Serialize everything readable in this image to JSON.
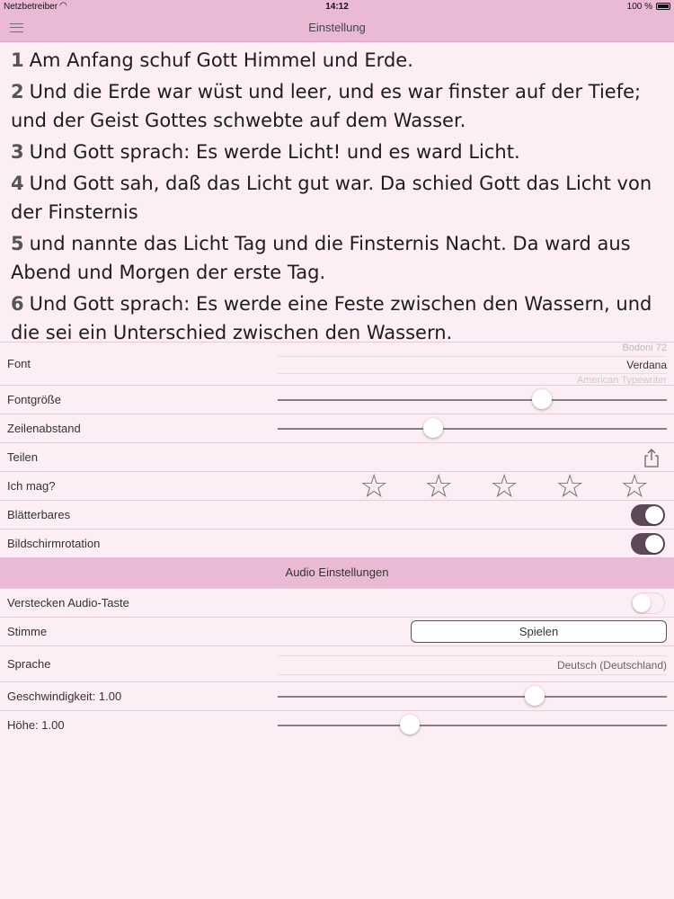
{
  "status": {
    "carrier": "Netzbetreiber",
    "time": "14:12",
    "battery": "100 %"
  },
  "nav": {
    "title": "Einstellung",
    "menu_icon": "hamburger-menu-icon"
  },
  "verses": [
    {
      "num": "1",
      "text": "Am Anfang schuf Gott Himmel und Erde."
    },
    {
      "num": "2",
      "text": "Und die Erde war wüst und leer, und es war finster auf der Tiefe; und der Geist Gottes schwebte auf dem Wasser."
    },
    {
      "num": "3",
      "text": "Und Gott sprach: Es werde Licht! und es ward Licht."
    },
    {
      "num": "4",
      "text": "Und Gott sah, daß das Licht gut war. Da schied Gott das Licht von der Finsternis"
    },
    {
      "num": "5",
      "text": "und nannte das Licht Tag und die Finsternis Nacht. Da ward aus Abend und Morgen der erste Tag."
    },
    {
      "num": "6",
      "text": "Und Gott sprach: Es werde eine Feste zwischen den Wassern, und die sei ein Unterschied zwischen den Wassern."
    }
  ],
  "settings": {
    "font_label": "Font",
    "font_above": "Bodoni 72",
    "font_selected": "Verdana",
    "font_below": "American Typewriter",
    "font_size_label": "Fontgröße",
    "font_size_value": 0.68,
    "line_spacing_label": "Zeilenabstand",
    "line_spacing_value": 0.4,
    "share_label": "Teilen",
    "like_label": "Ich mag?",
    "stars": [
      "☆",
      "☆",
      "☆",
      "☆",
      "☆"
    ],
    "paging_label": "Blätterbares",
    "paging_on": true,
    "rotation_label": "Bildschirmrotation",
    "rotation_on": true
  },
  "audio": {
    "header": "Audio Einstellungen",
    "hide_label": "Verstecken Audio-Taste",
    "hide_on": false,
    "voice_label": "Stimme",
    "play_label": "Spielen",
    "language_label": "Sprache",
    "language_value": "Deutsch (Deutschland)",
    "speed_label": "Geschwindigkeit: 1.00",
    "speed_value": 0.66,
    "pitch_label": "Höhe: 1.00",
    "pitch_value": 0.34
  }
}
